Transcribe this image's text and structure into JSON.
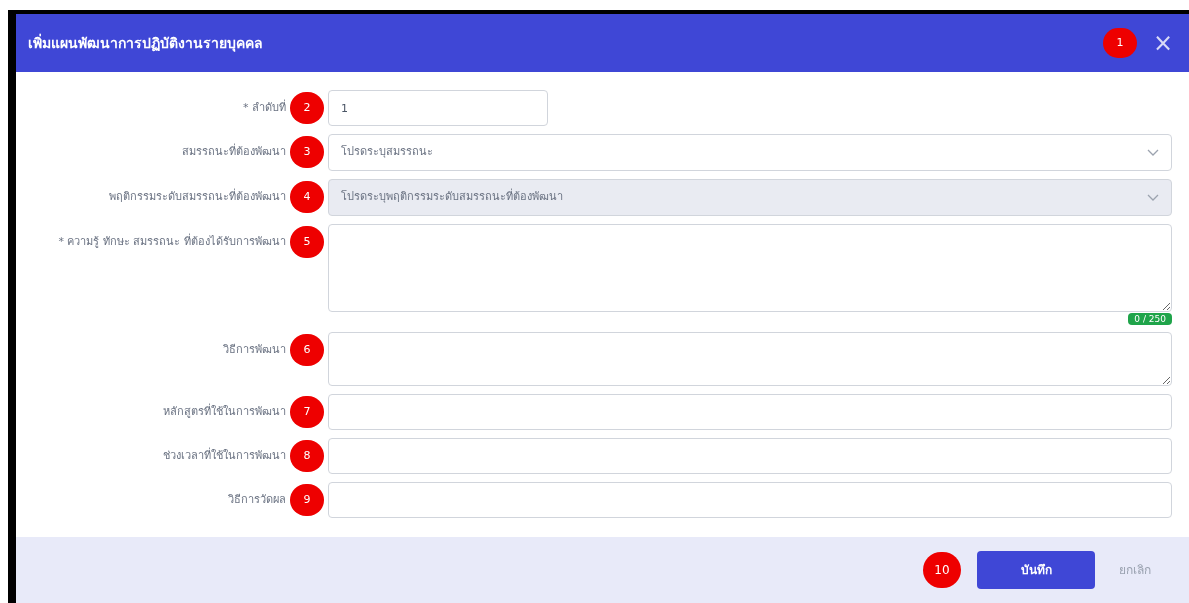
{
  "dialog": {
    "title": "เพิ่มแผนพัฒนาการปฏิบัติงานรายบุคคล",
    "close": "×",
    "marker": "1"
  },
  "fields": [
    {
      "kind": "input",
      "label": "* ลำดับที่",
      "marker": "2",
      "value": "1",
      "short": true
    },
    {
      "kind": "select",
      "label": "สมรรถนะที่ต้องพัฒนา",
      "marker": "3",
      "value": "โปรดระบุสมรรถนะ"
    },
    {
      "kind": "select",
      "label": "พฤติกรรมระดับสมรรถนะที่ต้องพัฒนา",
      "marker": "4",
      "value": "โปรดระบุพฤติกรรมระดับสมรรถนะที่ต้องพัฒนา",
      "disabled": true
    },
    {
      "kind": "textarea",
      "label": "* ความรู้ ทักษะ สมรรถนะ ที่ต้องได้รับการพัฒนา",
      "marker": "5",
      "tall": true,
      "counter": "0 / 250"
    },
    {
      "kind": "textarea",
      "label": "วิธีการพัฒนา",
      "marker": "6"
    },
    {
      "kind": "input",
      "label": "หลักสูตรที่ใช้ในการพัฒนา",
      "marker": "7"
    },
    {
      "kind": "input",
      "label": "ช่วงเวลาที่ใช้ในการพัฒนา",
      "marker": "8"
    },
    {
      "kind": "input",
      "label": "วิธีการวัดผล",
      "marker": "9"
    }
  ],
  "footer": {
    "marker": "10",
    "save": "บันทึก",
    "cancel": "ยกเลิก"
  }
}
